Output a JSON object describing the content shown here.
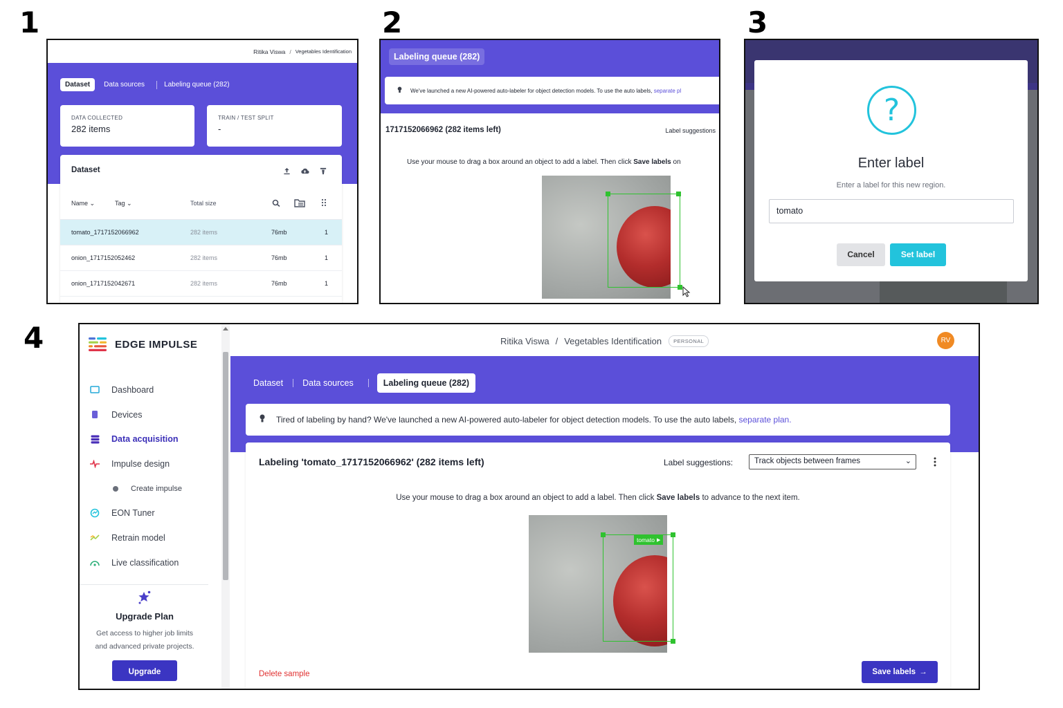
{
  "steps": [
    "1",
    "2",
    "3",
    "4"
  ],
  "p1": {
    "breadcrumb_user": "Ritika Viswa",
    "breadcrumb_sep": "/",
    "breadcrumb_project": "Vegetables Identification",
    "tabs": [
      "Dataset",
      "Data sources",
      "Labeling queue (282)"
    ],
    "data_collected_label": "DATA COLLECTED",
    "data_collected_value": "282 items",
    "split_label": "TRAIN / TEST SPLIT",
    "split_value": "-",
    "dataset_title": "Dataset",
    "columns": [
      "Name",
      "Tag",
      "Total size"
    ],
    "rows": [
      {
        "name": "tomato_1717152066962",
        "items": "282 items",
        "size": "76mb",
        "count": "1"
      },
      {
        "name": "onion_1717152052462",
        "items": "282 items",
        "size": "76mb",
        "count": "1"
      },
      {
        "name": "onion_1717152042671",
        "items": "282 items",
        "size": "76mb",
        "count": "1"
      }
    ]
  },
  "p2": {
    "tab": "Labeling queue (282)",
    "banner": "We've launched a new AI-powered auto-labeler for object detection models. To use the auto labels,",
    "banner_link": "separate pl",
    "title": "1717152066962 (282 items left)",
    "suggestions": "Label suggestions",
    "instruction_pre": "Use your mouse to drag a box around an object to add a label. Then click",
    "instruction_bold": "Save labels",
    "instruction_post": "on"
  },
  "p3": {
    "question_mark": "?",
    "title": "Enter label",
    "subtitle": "Enter a label for this new region.",
    "input_value": "tomato",
    "cancel": "Cancel",
    "set_label": "Set label"
  },
  "p4": {
    "brand": "EDGE IMPULSE",
    "breadcrumb_user": "Ritika Viswa",
    "breadcrumb_sep": "/",
    "breadcrumb_project": "Vegetables Identification",
    "badge": "PERSONAL",
    "avatar": "RV",
    "nav": [
      {
        "label": "Dashboard",
        "icon": "monitor-icon"
      },
      {
        "label": "Devices",
        "icon": "device-icon"
      },
      {
        "label": "Data acquisition",
        "icon": "database-icon"
      },
      {
        "label": "Impulse design",
        "icon": "impulse-icon"
      },
      {
        "label": "Create impulse",
        "icon": "dot-icon"
      },
      {
        "label": "EON Tuner",
        "icon": "tuner-icon"
      },
      {
        "label": "Retrain model",
        "icon": "retrain-icon"
      },
      {
        "label": "Live classification",
        "icon": "live-icon"
      }
    ],
    "upgrade_title": "Upgrade Plan",
    "upgrade_text": "Get access to higher job limits and advanced private projects.",
    "upgrade_button": "Upgrade",
    "tabs": [
      "Dataset",
      "Data sources",
      "Labeling queue (282)"
    ],
    "banner": "Tired of labeling by hand? We've launched a new AI-powered auto-labeler for object detection models. To use the auto labels,",
    "banner_link": "separate plan.",
    "title": "Labeling 'tomato_1717152066962' (282 items left)",
    "suggestions_label": "Label suggestions:",
    "suggestions_value": "Track objects between frames",
    "instruction_pre": "Use your mouse to drag a box around an object to add a label. Then click",
    "instruction_bold": "Save labels",
    "instruction_post": "to advance to the next item.",
    "box_label": "tomato",
    "delete": "Delete sample",
    "save": "Save labels"
  },
  "colors": {
    "brand_purple": "#5b4fd9",
    "accent_cyan": "#22c3dc",
    "bbox_green": "#2fc22f",
    "delete_red": "#e03131",
    "avatar_orange": "#f08a24"
  }
}
